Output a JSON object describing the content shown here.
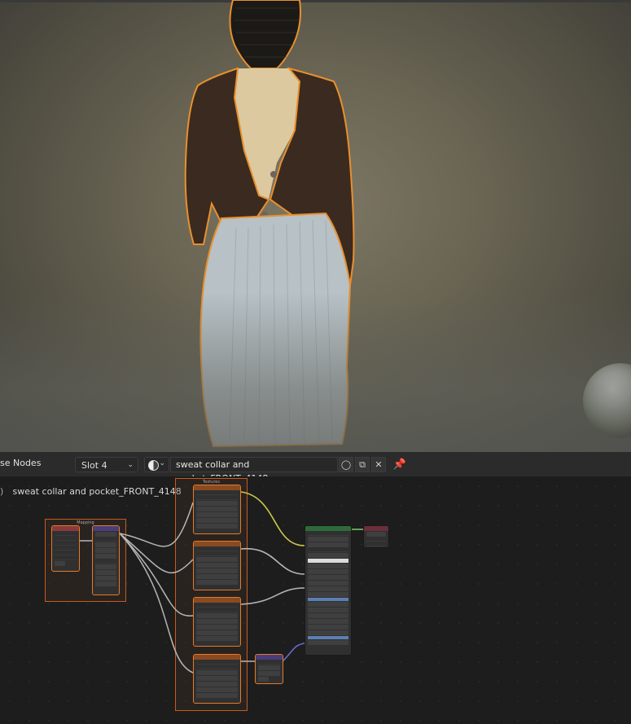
{
  "viewport": {
    "description_colors": {
      "outline": "#e8902e",
      "jacket": "#3b2a20",
      "skirt": "#b7c1c6",
      "shirt": "#dcc9a0"
    }
  },
  "header": {
    "editor_title": "se Nodes",
    "slot": "Slot 4",
    "material_name": "sweat collar and pocket_FRONT_4148",
    "icons": [
      "material-sphere-icon",
      "fake-user-shield-icon",
      "duplicate-icon",
      "close-icon",
      "pin-icon"
    ]
  },
  "editor": {
    "breadcrumb": "sweat collar and pocket_FRONT_4148",
    "frames": {
      "mapping": "Mapping",
      "textures": "Textures"
    },
    "colors": {
      "frame_border": "#c65a1d",
      "image_node_header": "#8a4a21",
      "mapping_node_header": "#8a3a3a",
      "vector_node_header": "#4b3d7a",
      "shader_node_header": "#2e6b3a",
      "output_node_header": "#6b2e3a",
      "link_yellow": "#c9c84a",
      "link_grey": "#b6b6b6",
      "link_blue": "#6a6acd"
    }
  }
}
